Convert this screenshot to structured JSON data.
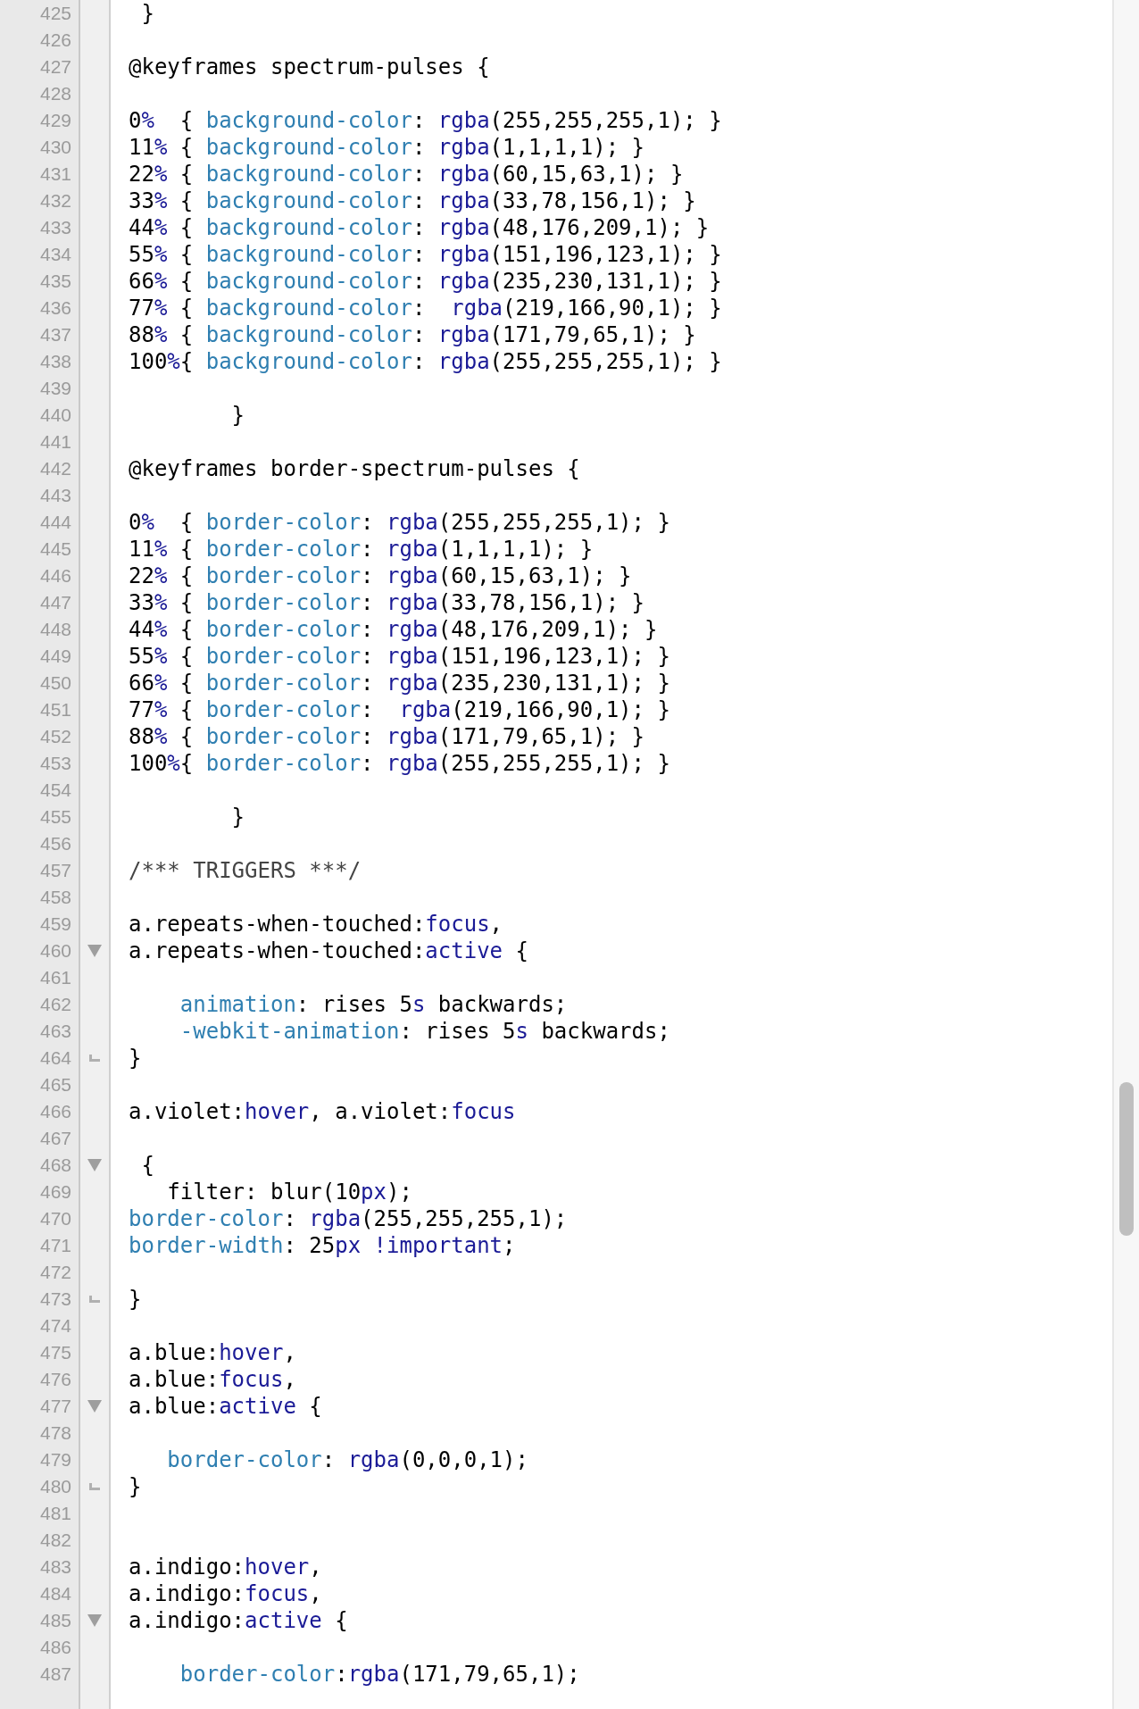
{
  "editor": {
    "lines": [
      {
        "number": "425",
        "tokens": [
          {
            "text": " }",
            "kind": "text"
          }
        ]
      },
      {
        "number": "426"
      },
      {
        "number": "427",
        "tokens": [
          {
            "text": "@keyframes spectrum-pulses {",
            "kind": "text"
          }
        ]
      },
      {
        "number": "428"
      },
      {
        "number": "429",
        "tokens": [
          {
            "text": "0",
            "kind": "text"
          },
          {
            "text": "%",
            "kind": "keyword"
          },
          {
            "text": "  { ",
            "kind": "text"
          },
          {
            "text": "background-color",
            "kind": "property"
          },
          {
            "text": ": ",
            "kind": "text"
          },
          {
            "text": "rgba",
            "kind": "keyword"
          },
          {
            "text": "(255,255,255,1); }",
            "kind": "text"
          }
        ]
      },
      {
        "number": "430",
        "tokens": [
          {
            "text": "11",
            "kind": "text"
          },
          {
            "text": "%",
            "kind": "keyword"
          },
          {
            "text": " { ",
            "kind": "text"
          },
          {
            "text": "background-color",
            "kind": "property"
          },
          {
            "text": ": ",
            "kind": "text"
          },
          {
            "text": "rgba",
            "kind": "keyword"
          },
          {
            "text": "(1,1,1,1); }",
            "kind": "text"
          }
        ]
      },
      {
        "number": "431",
        "tokens": [
          {
            "text": "22",
            "kind": "text"
          },
          {
            "text": "%",
            "kind": "keyword"
          },
          {
            "text": " { ",
            "kind": "text"
          },
          {
            "text": "background-color",
            "kind": "property"
          },
          {
            "text": ": ",
            "kind": "text"
          },
          {
            "text": "rgba",
            "kind": "keyword"
          },
          {
            "text": "(60,15,63,1); }",
            "kind": "text"
          }
        ]
      },
      {
        "number": "432",
        "tokens": [
          {
            "text": "33",
            "kind": "text"
          },
          {
            "text": "%",
            "kind": "keyword"
          },
          {
            "text": " { ",
            "kind": "text"
          },
          {
            "text": "background-color",
            "kind": "property"
          },
          {
            "text": ": ",
            "kind": "text"
          },
          {
            "text": "rgba",
            "kind": "keyword"
          },
          {
            "text": "(33,78,156,1); }",
            "kind": "text"
          }
        ]
      },
      {
        "number": "433",
        "tokens": [
          {
            "text": "44",
            "kind": "text"
          },
          {
            "text": "%",
            "kind": "keyword"
          },
          {
            "text": " { ",
            "kind": "text"
          },
          {
            "text": "background-color",
            "kind": "property"
          },
          {
            "text": ": ",
            "kind": "text"
          },
          {
            "text": "rgba",
            "kind": "keyword"
          },
          {
            "text": "(48,176,209,1); }",
            "kind": "text"
          }
        ]
      },
      {
        "number": "434",
        "tokens": [
          {
            "text": "55",
            "kind": "text"
          },
          {
            "text": "%",
            "kind": "keyword"
          },
          {
            "text": " { ",
            "kind": "text"
          },
          {
            "text": "background-color",
            "kind": "property"
          },
          {
            "text": ": ",
            "kind": "text"
          },
          {
            "text": "rgba",
            "kind": "keyword"
          },
          {
            "text": "(151,196,123,1); }",
            "kind": "text"
          }
        ]
      },
      {
        "number": "435",
        "tokens": [
          {
            "text": "66",
            "kind": "text"
          },
          {
            "text": "%",
            "kind": "keyword"
          },
          {
            "text": " { ",
            "kind": "text"
          },
          {
            "text": "background-color",
            "kind": "property"
          },
          {
            "text": ": ",
            "kind": "text"
          },
          {
            "text": "rgba",
            "kind": "keyword"
          },
          {
            "text": "(235,230,131,1); }",
            "kind": "text"
          }
        ]
      },
      {
        "number": "436",
        "tokens": [
          {
            "text": "77",
            "kind": "text"
          },
          {
            "text": "%",
            "kind": "keyword"
          },
          {
            "text": " { ",
            "kind": "text"
          },
          {
            "text": "background-color",
            "kind": "property"
          },
          {
            "text": ":  ",
            "kind": "text"
          },
          {
            "text": "rgba",
            "kind": "keyword"
          },
          {
            "text": "(219,166,90,1); }",
            "kind": "text"
          }
        ]
      },
      {
        "number": "437",
        "tokens": [
          {
            "text": "88",
            "kind": "text"
          },
          {
            "text": "%",
            "kind": "keyword"
          },
          {
            "text": " { ",
            "kind": "text"
          },
          {
            "text": "background-color",
            "kind": "property"
          },
          {
            "text": ": ",
            "kind": "text"
          },
          {
            "text": "rgba",
            "kind": "keyword"
          },
          {
            "text": "(171,79,65,1); }",
            "kind": "text"
          }
        ]
      },
      {
        "number": "438",
        "tokens": [
          {
            "text": "100",
            "kind": "text"
          },
          {
            "text": "%",
            "kind": "keyword"
          },
          {
            "text": "{ ",
            "kind": "text"
          },
          {
            "text": "background-color",
            "kind": "property"
          },
          {
            "text": ": ",
            "kind": "text"
          },
          {
            "text": "rgba",
            "kind": "keyword"
          },
          {
            "text": "(255,255,255,1); }",
            "kind": "text"
          }
        ]
      },
      {
        "number": "439"
      },
      {
        "number": "440",
        "tokens": [
          {
            "text": "        }",
            "kind": "text"
          }
        ]
      },
      {
        "number": "441"
      },
      {
        "number": "442",
        "tokens": [
          {
            "text": "@keyframes border-spectrum-pulses {",
            "kind": "text"
          }
        ]
      },
      {
        "number": "443"
      },
      {
        "number": "444",
        "tokens": [
          {
            "text": "0",
            "kind": "text"
          },
          {
            "text": "%",
            "kind": "keyword"
          },
          {
            "text": "  { ",
            "kind": "text"
          },
          {
            "text": "border-color",
            "kind": "property"
          },
          {
            "text": ": ",
            "kind": "text"
          },
          {
            "text": "rgba",
            "kind": "keyword"
          },
          {
            "text": "(255,255,255,1); }",
            "kind": "text"
          }
        ]
      },
      {
        "number": "445",
        "tokens": [
          {
            "text": "11",
            "kind": "text"
          },
          {
            "text": "%",
            "kind": "keyword"
          },
          {
            "text": " { ",
            "kind": "text"
          },
          {
            "text": "border-color",
            "kind": "property"
          },
          {
            "text": ": ",
            "kind": "text"
          },
          {
            "text": "rgba",
            "kind": "keyword"
          },
          {
            "text": "(1,1,1,1); }",
            "kind": "text"
          }
        ]
      },
      {
        "number": "446",
        "tokens": [
          {
            "text": "22",
            "kind": "text"
          },
          {
            "text": "%",
            "kind": "keyword"
          },
          {
            "text": " { ",
            "kind": "text"
          },
          {
            "text": "border-color",
            "kind": "property"
          },
          {
            "text": ": ",
            "kind": "text"
          },
          {
            "text": "rgba",
            "kind": "keyword"
          },
          {
            "text": "(60,15,63,1); }",
            "kind": "text"
          }
        ]
      },
      {
        "number": "447",
        "tokens": [
          {
            "text": "33",
            "kind": "text"
          },
          {
            "text": "%",
            "kind": "keyword"
          },
          {
            "text": " { ",
            "kind": "text"
          },
          {
            "text": "border-color",
            "kind": "property"
          },
          {
            "text": ": ",
            "kind": "text"
          },
          {
            "text": "rgba",
            "kind": "keyword"
          },
          {
            "text": "(33,78,156,1); }",
            "kind": "text"
          }
        ]
      },
      {
        "number": "448",
        "tokens": [
          {
            "text": "44",
            "kind": "text"
          },
          {
            "text": "%",
            "kind": "keyword"
          },
          {
            "text": " { ",
            "kind": "text"
          },
          {
            "text": "border-color",
            "kind": "property"
          },
          {
            "text": ": ",
            "kind": "text"
          },
          {
            "text": "rgba",
            "kind": "keyword"
          },
          {
            "text": "(48,176,209,1); }",
            "kind": "text"
          }
        ]
      },
      {
        "number": "449",
        "tokens": [
          {
            "text": "55",
            "kind": "text"
          },
          {
            "text": "%",
            "kind": "keyword"
          },
          {
            "text": " { ",
            "kind": "text"
          },
          {
            "text": "border-color",
            "kind": "property"
          },
          {
            "text": ": ",
            "kind": "text"
          },
          {
            "text": "rgba",
            "kind": "keyword"
          },
          {
            "text": "(151,196,123,1); }",
            "kind": "text"
          }
        ]
      },
      {
        "number": "450",
        "tokens": [
          {
            "text": "66",
            "kind": "text"
          },
          {
            "text": "%",
            "kind": "keyword"
          },
          {
            "text": " { ",
            "kind": "text"
          },
          {
            "text": "border-color",
            "kind": "property"
          },
          {
            "text": ": ",
            "kind": "text"
          },
          {
            "text": "rgba",
            "kind": "keyword"
          },
          {
            "text": "(235,230,131,1); }",
            "kind": "text"
          }
        ]
      },
      {
        "number": "451",
        "tokens": [
          {
            "text": "77",
            "kind": "text"
          },
          {
            "text": "%",
            "kind": "keyword"
          },
          {
            "text": " { ",
            "kind": "text"
          },
          {
            "text": "border-color",
            "kind": "property"
          },
          {
            "text": ":  ",
            "kind": "text"
          },
          {
            "text": "rgba",
            "kind": "keyword"
          },
          {
            "text": "(219,166,90,1); }",
            "kind": "text"
          }
        ]
      },
      {
        "number": "452",
        "tokens": [
          {
            "text": "88",
            "kind": "text"
          },
          {
            "text": "%",
            "kind": "keyword"
          },
          {
            "text": " { ",
            "kind": "text"
          },
          {
            "text": "border-color",
            "kind": "property"
          },
          {
            "text": ": ",
            "kind": "text"
          },
          {
            "text": "rgba",
            "kind": "keyword"
          },
          {
            "text": "(171,79,65,1); }",
            "kind": "text"
          }
        ]
      },
      {
        "number": "453",
        "tokens": [
          {
            "text": "100",
            "kind": "text"
          },
          {
            "text": "%",
            "kind": "keyword"
          },
          {
            "text": "{ ",
            "kind": "text"
          },
          {
            "text": "border-color",
            "kind": "property"
          },
          {
            "text": ": ",
            "kind": "text"
          },
          {
            "text": "rgba",
            "kind": "keyword"
          },
          {
            "text": "(255,255,255,1); }",
            "kind": "text"
          }
        ]
      },
      {
        "number": "454"
      },
      {
        "number": "455",
        "tokens": [
          {
            "text": "        }",
            "kind": "text"
          }
        ]
      },
      {
        "number": "456"
      },
      {
        "number": "457",
        "tokens": [
          {
            "text": "/*** TRIGGERS ***/",
            "kind": "comment"
          }
        ]
      },
      {
        "number": "458"
      },
      {
        "number": "459",
        "tokens": [
          {
            "text": "a.repeats-when-touched:",
            "kind": "text"
          },
          {
            "text": "focus",
            "kind": "keyword"
          },
          {
            "text": ",",
            "kind": "text"
          }
        ]
      },
      {
        "number": "460",
        "fold_start": true,
        "tokens": [
          {
            "text": "a.repeats-when-touched:",
            "kind": "text"
          },
          {
            "text": "active",
            "kind": "keyword"
          },
          {
            "text": " {",
            "kind": "text"
          }
        ]
      },
      {
        "number": "461"
      },
      {
        "number": "462",
        "tokens": [
          {
            "text": "    animation",
            "kind": "property"
          },
          {
            "text": ": rises 5",
            "kind": "text"
          },
          {
            "text": "s",
            "kind": "keyword"
          },
          {
            "text": " backwards;",
            "kind": "text"
          }
        ]
      },
      {
        "number": "463",
        "tokens": [
          {
            "text": "    -webkit-animation",
            "kind": "property"
          },
          {
            "text": ": rises 5",
            "kind": "text"
          },
          {
            "text": "s",
            "kind": "keyword"
          },
          {
            "text": " backwards;",
            "kind": "text"
          }
        ]
      },
      {
        "number": "464",
        "fold_end": true,
        "tokens": [
          {
            "text": "}",
            "kind": "text"
          }
        ]
      },
      {
        "number": "465"
      },
      {
        "number": "466",
        "tokens": [
          {
            "text": "a.violet:",
            "kind": "text"
          },
          {
            "text": "hover",
            "kind": "keyword"
          },
          {
            "text": ", a.violet:",
            "kind": "text"
          },
          {
            "text": "focus",
            "kind": "keyword"
          }
        ]
      },
      {
        "number": "467"
      },
      {
        "number": "468",
        "fold_start": true,
        "tokens": [
          {
            "text": " {",
            "kind": "text"
          }
        ]
      },
      {
        "number": "469",
        "tokens": [
          {
            "text": "   filter: blur(10",
            "kind": "text"
          },
          {
            "text": "px",
            "kind": "keyword"
          },
          {
            "text": ");",
            "kind": "text"
          }
        ]
      },
      {
        "number": "470",
        "tokens": [
          {
            "text": "border-color",
            "kind": "property"
          },
          {
            "text": ": ",
            "kind": "text"
          },
          {
            "text": "rgba",
            "kind": "keyword"
          },
          {
            "text": "(255,255,255,1);",
            "kind": "text"
          }
        ]
      },
      {
        "number": "471",
        "tokens": [
          {
            "text": "border-width",
            "kind": "property"
          },
          {
            "text": ": 25",
            "kind": "text"
          },
          {
            "text": "px !important",
            "kind": "keyword"
          },
          {
            "text": ";",
            "kind": "text"
          }
        ]
      },
      {
        "number": "472"
      },
      {
        "number": "473",
        "fold_end": true,
        "tokens": [
          {
            "text": "}",
            "kind": "text"
          }
        ]
      },
      {
        "number": "474"
      },
      {
        "number": "475",
        "tokens": [
          {
            "text": "a.blue:",
            "kind": "text"
          },
          {
            "text": "hover",
            "kind": "keyword"
          },
          {
            "text": ",",
            "kind": "text"
          }
        ]
      },
      {
        "number": "476",
        "tokens": [
          {
            "text": "a.blue:",
            "kind": "text"
          },
          {
            "text": "focus",
            "kind": "keyword"
          },
          {
            "text": ",",
            "kind": "text"
          }
        ]
      },
      {
        "number": "477",
        "fold_start": true,
        "tokens": [
          {
            "text": "a.blue:",
            "kind": "text"
          },
          {
            "text": "active",
            "kind": "keyword"
          },
          {
            "text": " {",
            "kind": "text"
          }
        ]
      },
      {
        "number": "478"
      },
      {
        "number": "479",
        "tokens": [
          {
            "text": "   border-color",
            "kind": "property"
          },
          {
            "text": ": ",
            "kind": "text"
          },
          {
            "text": "rgba",
            "kind": "keyword"
          },
          {
            "text": "(0,0,0,1);",
            "kind": "text"
          }
        ]
      },
      {
        "number": "480",
        "fold_end": true,
        "tokens": [
          {
            "text": "}",
            "kind": "text"
          }
        ]
      },
      {
        "number": "481"
      },
      {
        "number": "482"
      },
      {
        "number": "483",
        "tokens": [
          {
            "text": "a.indigo:",
            "kind": "text"
          },
          {
            "text": "hover",
            "kind": "keyword"
          },
          {
            "text": ",",
            "kind": "text"
          }
        ]
      },
      {
        "number": "484",
        "tokens": [
          {
            "text": "a.indigo:",
            "kind": "text"
          },
          {
            "text": "focus",
            "kind": "keyword"
          },
          {
            "text": ",",
            "kind": "text"
          }
        ]
      },
      {
        "number": "485",
        "fold_start": true,
        "tokens": [
          {
            "text": "a.indigo:",
            "kind": "text"
          },
          {
            "text": "active",
            "kind": "keyword"
          },
          {
            "text": " {",
            "kind": "text"
          }
        ]
      },
      {
        "number": "486"
      },
      {
        "number": "487",
        "tokens": [
          {
            "text": "    border-color",
            "kind": "property"
          },
          {
            "text": ":",
            "kind": "text"
          },
          {
            "text": "rgba",
            "kind": "keyword"
          },
          {
            "text": "(171,79,65,1);",
            "kind": "text"
          }
        ]
      }
    ]
  }
}
